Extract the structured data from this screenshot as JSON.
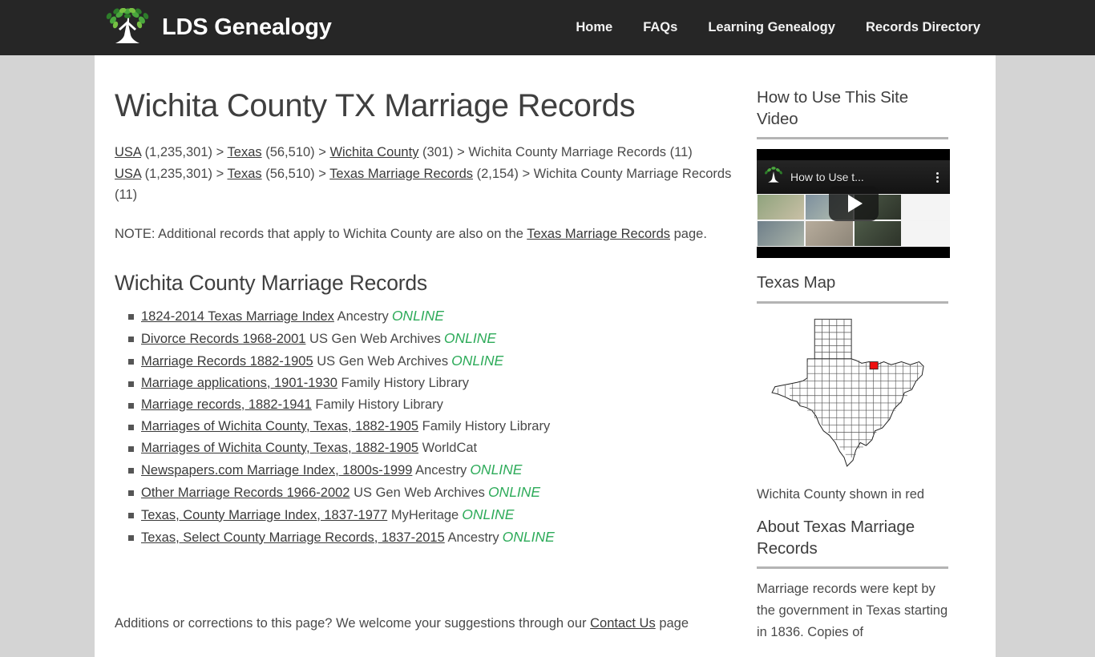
{
  "header": {
    "brand_name": "LDS Genealogy",
    "logo_icon": "tree-logo-icon",
    "nav": [
      {
        "label": "Home",
        "name": "nav-home"
      },
      {
        "label": "FAQs",
        "name": "nav-faqs"
      },
      {
        "label": "Learning Genealogy",
        "name": "nav-learning-genealogy"
      },
      {
        "label": "Records Directory",
        "name": "nav-records-directory"
      }
    ]
  },
  "main": {
    "page_title": "Wichita County TX Marriage Records",
    "breadcrumb_1": {
      "usa": "USA",
      "usa_count": " (1,235,301) > ",
      "texas": "Texas",
      "texas_count": " (56,510) > ",
      "county": "Wichita County",
      "county_count": " (301) > ",
      "current": "Wichita County Marriage Records (11)"
    },
    "breadcrumb_2": {
      "usa": "USA",
      "usa_count": " (1,235,301) > ",
      "texas": "Texas",
      "texas_count": " (56,510) > ",
      "state_records": "Texas Marriage Records",
      "state_records_count": " (2,154) > ",
      "current": "Wichita County Marriage Records (11)"
    },
    "note_prefix": "NOTE: Additional records that apply to Wichita County are also on the ",
    "note_link": "Texas Marriage Records",
    "note_suffix": " page.",
    "section_title": "Wichita County Marriage Records",
    "records": [
      {
        "title": "1824-2014 Texas Marriage Index",
        "source": "Ancestry",
        "online": "ONLINE"
      },
      {
        "title": "Divorce Records 1968-2001",
        "source": "US Gen Web Archives",
        "online": "ONLINE"
      },
      {
        "title": "Marriage Records 1882-1905",
        "source": "US Gen Web Archives",
        "online": "ONLINE"
      },
      {
        "title": "Marriage applications, 1901-1930",
        "source": "Family History Library",
        "online": ""
      },
      {
        "title": "Marriage records, 1882-1941",
        "source": "Family History Library",
        "online": ""
      },
      {
        "title": "Marriages of Wichita County, Texas, 1882-1905",
        "source": "Family History Library",
        "online": ""
      },
      {
        "title": "Marriages of Wichita County, Texas, 1882-1905",
        "source": "WorldCat",
        "online": ""
      },
      {
        "title": "Newspapers.com Marriage Index, 1800s-1999",
        "source": "Ancestry",
        "online": "ONLINE"
      },
      {
        "title": "Other Marriage Records 1966-2002",
        "source": "US Gen Web Archives",
        "online": "ONLINE"
      },
      {
        "title": "Texas, County Marriage Index, 1837-1977",
        "source": "MyHeritage",
        "online": "ONLINE"
      },
      {
        "title": "Texas, Select County Marriage Records, 1837-2015",
        "source": "Ancestry",
        "online": "ONLINE"
      }
    ],
    "footnote_prefix": "Additions or corrections to this page? We welcome your suggestions through our ",
    "footnote_link": "Contact Us",
    "footnote_suffix": " page"
  },
  "sidebar": {
    "video_widget": {
      "title": "How to Use This Site Video",
      "player_title": "How to Use t...",
      "play_icon": "play-button-icon",
      "menu_icon": "kebab-menu-icon"
    },
    "map_widget": {
      "title": "Texas Map",
      "caption": "Wichita County shown in red",
      "highlight_color": "#ee1111"
    },
    "about_widget": {
      "title": "About Texas Marriage Records",
      "body": "Marriage records were kept by the government in Texas starting in 1836. Copies of"
    }
  },
  "colors": {
    "header_bg": "#262626",
    "page_bg": "#d4d4d4",
    "content_bg": "#ffffff",
    "online_green": "#2eab5a",
    "text": "#4a4a4a"
  }
}
